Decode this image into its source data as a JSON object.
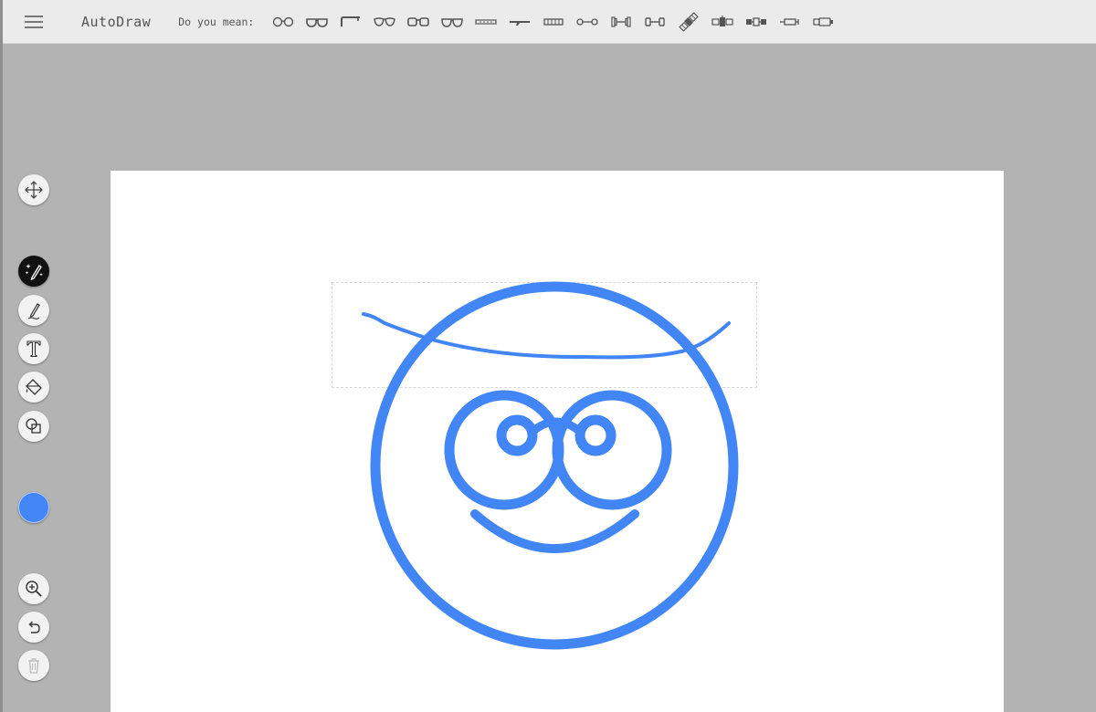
{
  "app": {
    "title": "AutoDraw"
  },
  "toolbar": {
    "suggest_label": "Do you mean:",
    "suggestions": [
      "glasses",
      "sunglasses",
      "cane",
      "aviator-glasses",
      "square-glasses",
      "round-glasses",
      "flute",
      "rifle",
      "harmonica",
      "dumbbell",
      "dumbbell-weights",
      "barbell",
      "satellite",
      "space-station",
      "satellite-module",
      "syringe",
      "battery"
    ]
  },
  "tools": [
    {
      "name": "select-move",
      "icon": "move-arrows-icon"
    },
    {
      "name": "autodraw",
      "icon": "autodraw-sparkle-icon",
      "active": true
    },
    {
      "name": "draw",
      "icon": "pencil-icon"
    },
    {
      "name": "type",
      "icon": "text-t-icon"
    },
    {
      "name": "fill",
      "icon": "paint-bucket-icon"
    },
    {
      "name": "shape",
      "icon": "shapes-icon"
    },
    {
      "name": "zoom",
      "icon": "zoom-in-icon"
    },
    {
      "name": "undo",
      "icon": "undo-icon"
    },
    {
      "name": "delete",
      "icon": "trash-icon",
      "disabled": true
    }
  ],
  "colors": {
    "stroke": "#4285f4",
    "active_tool_bg": "#111111",
    "background": "#b3b3b3",
    "canvas": "#ffffff"
  }
}
